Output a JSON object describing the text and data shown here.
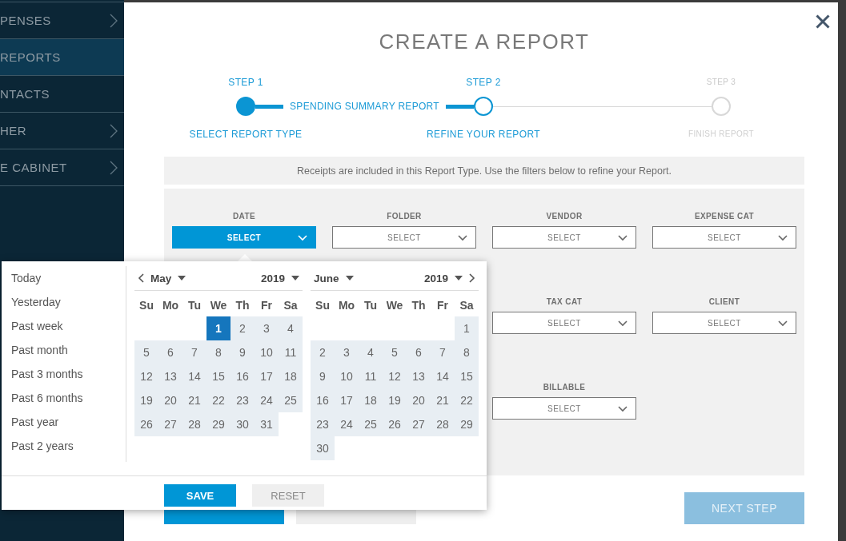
{
  "sidebar": {
    "items": [
      {
        "label": "PENSES",
        "selected": false,
        "has_submenu": true
      },
      {
        "label": "REPORTS",
        "selected": true,
        "has_submenu": false
      },
      {
        "label": "NTACTS",
        "selected": false,
        "has_submenu": false
      },
      {
        "label": "HER",
        "selected": false,
        "has_submenu": true
      },
      {
        "label": "E CABINET",
        "selected": false,
        "has_submenu": true
      }
    ]
  },
  "modal": {
    "title": "CREATE A REPORT",
    "steps": [
      {
        "label": "STEP 1",
        "caption": "SELECT REPORT TYPE",
        "completed": true,
        "current": false,
        "value": "SPENDING SUMMARY REPORT"
      },
      {
        "label": "STEP 2",
        "caption": "REFINE YOUR REPORT",
        "completed": false,
        "current": true
      },
      {
        "label": "STEP 3",
        "caption": "FINISH REPORT",
        "completed": false,
        "current": false
      }
    ],
    "info": "Receipts are included in this Report Type. Use the filters below to refine your Report.",
    "filter_rows": [
      [
        {
          "label": "DATE",
          "value": "SELECT",
          "open": true
        },
        {
          "label": "FOLDER",
          "value": "SELECT",
          "open": false
        },
        {
          "label": "VENDOR",
          "value": "SELECT",
          "open": false
        },
        {
          "label": "EXPENSE CAT",
          "value": "SELECT",
          "open": false
        }
      ],
      [
        {
          "label": "TAX CAT",
          "value": "SELECT",
          "open": false
        },
        {
          "label": "CLIENT",
          "value": "SELECT",
          "open": false
        }
      ],
      [
        {
          "label": "BILLABLE",
          "value": "SELECT",
          "open": false
        }
      ]
    ],
    "buttons": [
      {
        "kind": "primary",
        "disabled": false
      },
      {
        "kind": "secondary",
        "disabled": false
      },
      {
        "label": "NEXT STEP",
        "kind": "primary",
        "disabled": true
      }
    ]
  },
  "date_picker": {
    "presets": [
      {
        "label": "Today",
        "selected": false
      },
      {
        "label": "Yesterday",
        "selected": false
      },
      {
        "label": "Past week",
        "selected": false
      },
      {
        "label": "Past month",
        "selected": false
      },
      {
        "label": "Past 3 months",
        "selected": false
      },
      {
        "label": "Past 6 months",
        "selected": false
      },
      {
        "label": "Past year",
        "selected": false
      },
      {
        "label": "Past 2 years",
        "selected": false
      }
    ],
    "months": [
      {
        "month": "May",
        "year": "2019",
        "prev_arrow": true,
        "next_arrow": false,
        "weekdays": [
          "Su",
          "Mo",
          "Tu",
          "We",
          "Th",
          "Fr",
          "Sa"
        ],
        "weeks": [
          [
            {
              "kind": "blank"
            },
            {
              "kind": "blank"
            },
            {
              "kind": "blank"
            },
            {
              "d": "1",
              "selected": true,
              "in_range": true
            },
            {
              "d": "2",
              "selected": false,
              "in_range": true
            },
            {
              "d": "3",
              "selected": false,
              "in_range": true
            },
            {
              "d": "4",
              "selected": false,
              "in_range": true
            }
          ],
          [
            {
              "d": "5",
              "selected": false,
              "in_range": true
            },
            {
              "d": "6",
              "selected": false,
              "in_range": true
            },
            {
              "d": "7",
              "selected": false,
              "in_range": true
            },
            {
              "d": "8",
              "selected": false,
              "in_range": true
            },
            {
              "d": "9",
              "selected": false,
              "in_range": true
            },
            {
              "d": "10",
              "selected": false,
              "in_range": true
            },
            {
              "d": "11",
              "selected": false,
              "in_range": true
            }
          ],
          [
            {
              "d": "12",
              "selected": false,
              "in_range": true
            },
            {
              "d": "13",
              "selected": false,
              "in_range": true
            },
            {
              "d": "14",
              "selected": false,
              "in_range": true
            },
            {
              "d": "15",
              "selected": false,
              "in_range": true
            },
            {
              "d": "16",
              "selected": false,
              "in_range": true
            },
            {
              "d": "17",
              "selected": false,
              "in_range": true
            },
            {
              "d": "18",
              "selected": false,
              "in_range": true
            }
          ],
          [
            {
              "d": "19",
              "selected": false,
              "in_range": true
            },
            {
              "d": "20",
              "selected": false,
              "in_range": true
            },
            {
              "d": "21",
              "selected": false,
              "in_range": true
            },
            {
              "d": "22",
              "selected": false,
              "in_range": true
            },
            {
              "d": "23",
              "selected": false,
              "in_range": true
            },
            {
              "d": "24",
              "selected": false,
              "in_range": true
            },
            {
              "d": "25",
              "selected": false,
              "in_range": true
            }
          ],
          [
            {
              "d": "26",
              "selected": false,
              "in_range": true
            },
            {
              "d": "27",
              "selected": false,
              "in_range": true
            },
            {
              "d": "28",
              "selected": false,
              "in_range": true
            },
            {
              "d": "29",
              "selected": false,
              "in_range": true
            },
            {
              "d": "30",
              "selected": false,
              "in_range": true
            },
            {
              "d": "31",
              "selected": false,
              "in_range": true
            },
            {
              "kind": "blank"
            }
          ]
        ]
      },
      {
        "month": "June",
        "year": "2019",
        "prev_arrow": false,
        "next_arrow": true,
        "weekdays": [
          "Su",
          "Mo",
          "Tu",
          "We",
          "Th",
          "Fr",
          "Sa"
        ],
        "weeks": [
          [
            {
              "kind": "blank"
            },
            {
              "kind": "blank"
            },
            {
              "kind": "blank"
            },
            {
              "kind": "blank"
            },
            {
              "kind": "blank"
            },
            {
              "kind": "blank"
            },
            {
              "d": "1",
              "selected": false,
              "in_range": true
            }
          ],
          [
            {
              "d": "2",
              "selected": false,
              "in_range": true
            },
            {
              "d": "3",
              "selected": false,
              "in_range": true
            },
            {
              "d": "4",
              "selected": false,
              "in_range": true
            },
            {
              "d": "5",
              "selected": false,
              "in_range": true
            },
            {
              "d": "6",
              "selected": false,
              "in_range": true
            },
            {
              "d": "7",
              "selected": false,
              "in_range": true
            },
            {
              "d": "8",
              "selected": false,
              "in_range": true
            }
          ],
          [
            {
              "d": "9",
              "selected": false,
              "in_range": true
            },
            {
              "d": "10",
              "selected": false,
              "in_range": true
            },
            {
              "d": "11",
              "selected": false,
              "in_range": true
            },
            {
              "d": "12",
              "selected": false,
              "in_range": true
            },
            {
              "d": "13",
              "selected": false,
              "in_range": true
            },
            {
              "d": "14",
              "selected": false,
              "in_range": true
            },
            {
              "d": "15",
              "selected": false,
              "in_range": true
            }
          ],
          [
            {
              "d": "16",
              "selected": false,
              "in_range": true
            },
            {
              "d": "17",
              "selected": false,
              "in_range": true
            },
            {
              "d": "18",
              "selected": false,
              "in_range": true
            },
            {
              "d": "19",
              "selected": false,
              "in_range": true
            },
            {
              "d": "20",
              "selected": false,
              "in_range": true
            },
            {
              "d": "21",
              "selected": false,
              "in_range": true
            },
            {
              "d": "22",
              "selected": false,
              "in_range": true
            }
          ],
          [
            {
              "d": "23",
              "selected": false,
              "in_range": true
            },
            {
              "d": "24",
              "selected": false,
              "in_range": true
            },
            {
              "d": "25",
              "selected": false,
              "in_range": true
            },
            {
              "d": "26",
              "selected": false,
              "in_range": true
            },
            {
              "d": "27",
              "selected": false,
              "in_range": true
            },
            {
              "d": "28",
              "selected": false,
              "in_range": true
            },
            {
              "d": "29",
              "selected": false,
              "in_range": true
            }
          ],
          [
            {
              "d": "30",
              "selected": false,
              "in_range": true
            },
            {
              "kind": "blank"
            },
            {
              "kind": "blank"
            },
            {
              "kind": "blank"
            },
            {
              "kind": "blank"
            },
            {
              "kind": "blank"
            },
            {
              "kind": "blank"
            }
          ]
        ]
      }
    ],
    "buttons": [
      {
        "label": "SAVE",
        "kind": "primary"
      },
      {
        "label": "RESET",
        "kind": "secondary"
      }
    ]
  }
}
